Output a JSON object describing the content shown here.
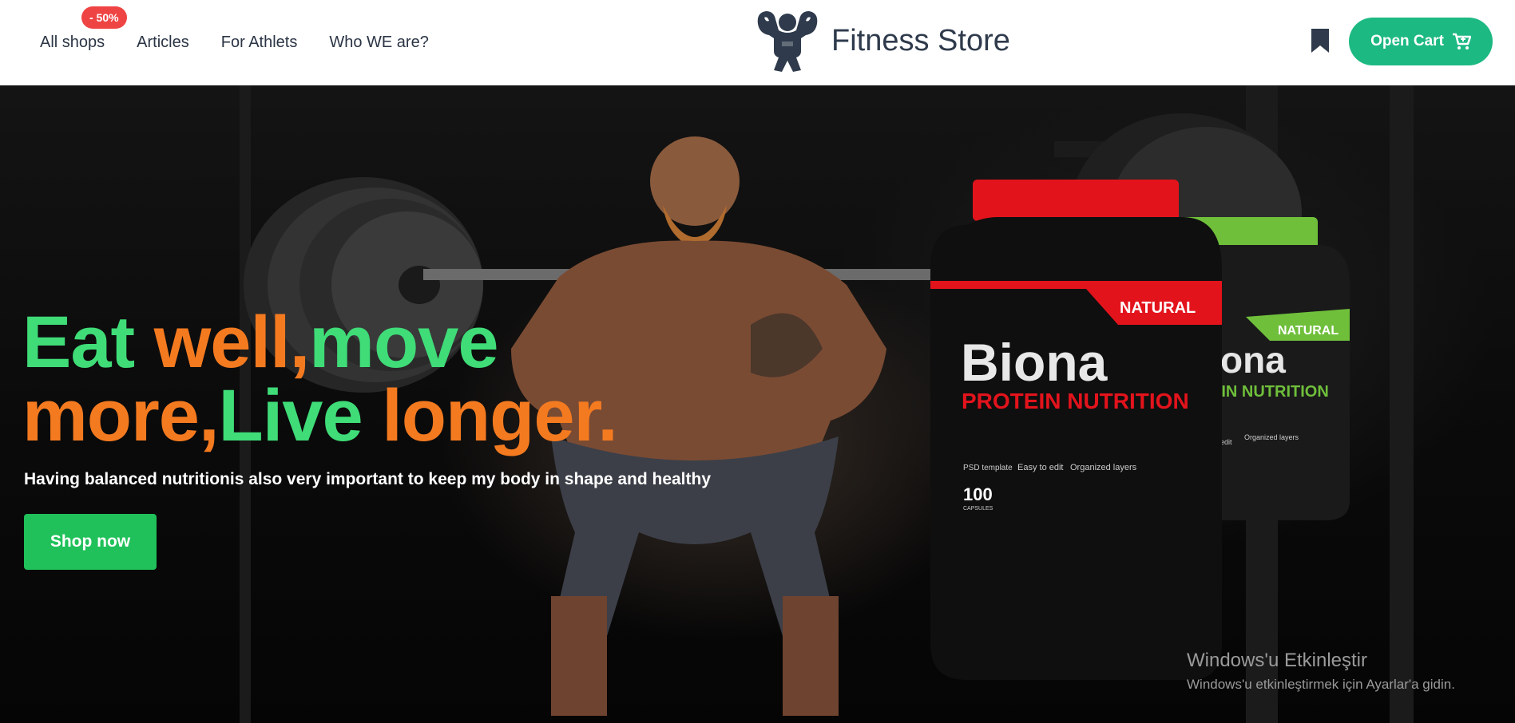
{
  "header": {
    "nav": [
      {
        "label": "All shops"
      },
      {
        "label": "Articles"
      },
      {
        "label": "For Athlets"
      },
      {
        "label": "Who WE are?"
      }
    ],
    "badge": "- 50%",
    "logo_text": "Fitness Store",
    "cart_label": "Open Cart",
    "icons": {
      "logo": "strongman-logo-icon",
      "bookmark": "bookmark-icon",
      "cart": "cart-icon"
    }
  },
  "hero": {
    "headline": {
      "w1": "Eat",
      "w2": "well,",
      "w3": "move",
      "w4": "more,",
      "w5": "Live",
      "w6": "longer."
    },
    "subline": "Having balanced nutritionis also very important to keep my body in shape and healthy",
    "cta": "Shop now",
    "product": {
      "tag": "NATURAL",
      "brand": "Biona",
      "line": "PROTEIN NUTRITION",
      "feature_1": "PSD template",
      "feature_2": "Easy to edit",
      "feature_3": "Organized layers",
      "count": "100",
      "count_unit": "CAPSULES",
      "back_tag": "NATURAL",
      "back_brand": "ona",
      "back_line": "EIN NUTRITION",
      "back_feature_1": "edit",
      "back_feature_2": "Organized layers"
    }
  },
  "watermark": {
    "title": "Windows'u Etkinleştir",
    "subtitle": "Windows'u etkinleştirmek için Ayarlar'a gidin."
  },
  "colors": {
    "accent_green": "#3fdc78",
    "accent_orange": "#f47a20",
    "cart_button": "#1db982",
    "shop_button": "#20c15a",
    "badge": "#ef4444",
    "text_dark": "#2b3545"
  }
}
